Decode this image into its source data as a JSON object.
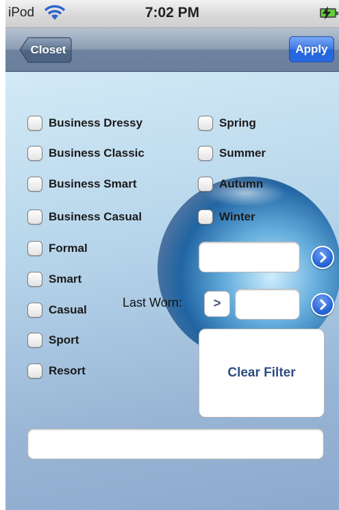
{
  "status_bar": {
    "carrier": "iPod",
    "time": "7:02 PM"
  },
  "nav_bar": {
    "back_label": "Closet",
    "apply_label": "Apply"
  },
  "style_options": [
    {
      "label": "Business Dressy",
      "checked": false
    },
    {
      "label": "Business Classic",
      "checked": false
    },
    {
      "label": "Business Smart",
      "checked": false
    },
    {
      "label": "Business Casual",
      "checked": false
    },
    {
      "label": "Formal",
      "checked": false
    },
    {
      "label": "Smart",
      "checked": false
    },
    {
      "label": "Casual",
      "checked": false
    },
    {
      "label": "Sport",
      "checked": false
    },
    {
      "label": "Resort",
      "checked": false
    }
  ],
  "season_options": [
    {
      "label": "Spring",
      "checked": false
    },
    {
      "label": "Summer",
      "checked": false
    },
    {
      "label": "Autumn",
      "checked": false
    },
    {
      "label": "Winter",
      "checked": false
    }
  ],
  "filter_field": {
    "value": ""
  },
  "last_worn": {
    "label": "Last Worn:",
    "operator": ">",
    "value": ""
  },
  "clear_filter_label": "Clear Filter",
  "bottom_field": {
    "value": ""
  },
  "colors": {
    "accent": "#2a67d9",
    "nav_bar": "#7d90aa",
    "apply_button": "#3b78e6",
    "clear_filter_text": "#2e4d7e"
  },
  "icons": [
    "wifi-icon",
    "battery-icon",
    "charging-icon",
    "chevron-right-icon"
  ]
}
